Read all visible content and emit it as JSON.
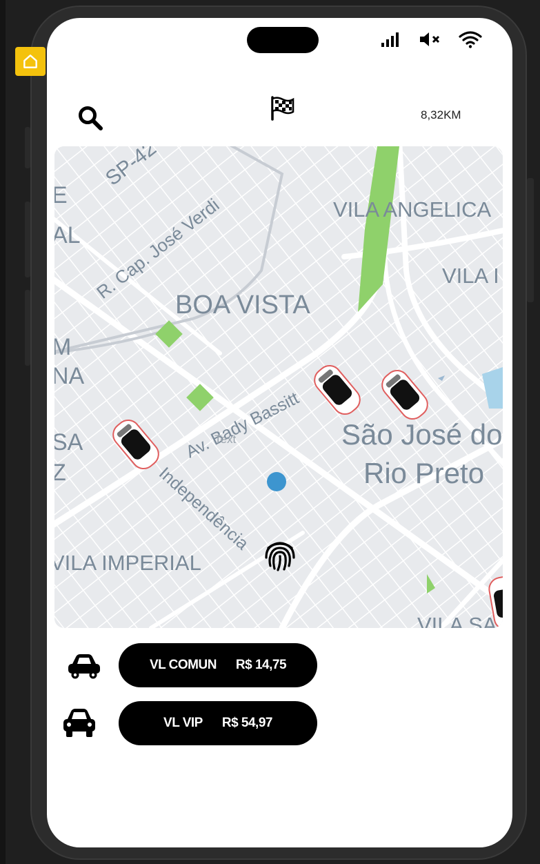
{
  "header": {
    "distance": "8,32KM"
  },
  "map": {
    "labels": {
      "sp": "SP-42",
      "street_verdi": "R. Cap. José Verdi",
      "vila_angelica": "VILA ANGELICA",
      "vila_right": "VILA I",
      "left_al": "AL",
      "left_e": "E",
      "left_m": "M",
      "left_na": "NA",
      "left_sa": "SA",
      "left_z": "Z",
      "boa_vista": "BOA VISTA",
      "av_bady": "Av. Bady Bassitt",
      "text_overlay": "Text",
      "sao_jose_1": "São José do",
      "sao_jose_2": "Rio Preto",
      "independencia": "Independência",
      "vila_imperial": "VILA IMPERIAL",
      "vila_sa": "VILA SA"
    },
    "colors": {
      "background": "#e8eaed",
      "road": "#ffffff",
      "park": "#8fd16b",
      "label": "#7a8a99",
      "user_dot": "#3d95cf"
    }
  },
  "rides": [
    {
      "name": "VL COMUN",
      "price": "R$ 14,75",
      "icon": "car-front-icon"
    },
    {
      "name": "VL VIP",
      "price": "R$ 54,97",
      "icon": "car-front-icon"
    }
  ]
}
